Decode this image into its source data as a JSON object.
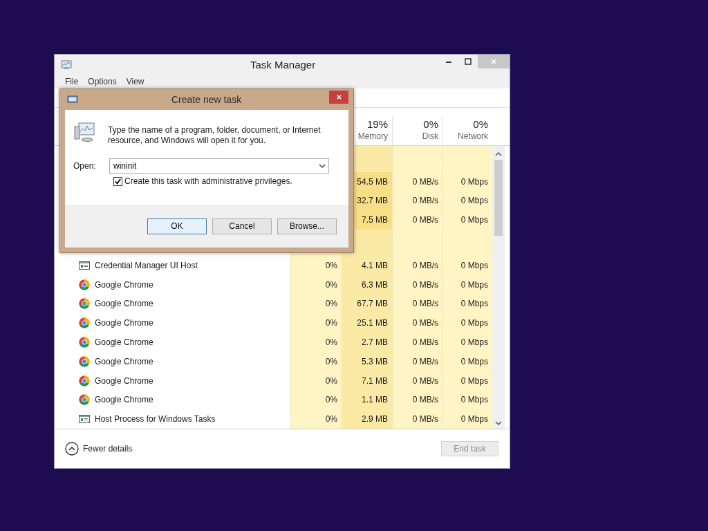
{
  "window": {
    "title": "Task Manager"
  },
  "menu": [
    "File",
    "Options",
    "View"
  ],
  "columns": [
    {
      "percent": "19%",
      "label": "Memory"
    },
    {
      "percent": "0%",
      "label": "Disk"
    },
    {
      "percent": "0%",
      "label": "Network"
    }
  ],
  "rows": [
    {
      "kind": "group"
    },
    {
      "kind": "hidden",
      "memory": "54.5 MB",
      "disk": "0 MB/s",
      "network": "0 Mbps"
    },
    {
      "kind": "hidden",
      "memory": "32.7 MB",
      "disk": "0 MB/s",
      "network": "0 Mbps"
    },
    {
      "kind": "hidden",
      "memory": "7.5 MB",
      "disk": "0 MB/s",
      "network": "0 Mbps"
    },
    {
      "kind": "group"
    },
    {
      "kind": "app",
      "name": "Credential Manager UI Host",
      "cpu": "0%",
      "memory": "4.1 MB",
      "disk": "0 MB/s",
      "network": "0 Mbps"
    },
    {
      "kind": "chrome",
      "name": "Google Chrome",
      "cpu": "0%",
      "memory": "6.3 MB",
      "disk": "0 MB/s",
      "network": "0 Mbps"
    },
    {
      "kind": "chrome",
      "name": "Google Chrome",
      "cpu": "0%",
      "memory": "67.7 MB",
      "disk": "0 MB/s",
      "network": "0 Mbps"
    },
    {
      "kind": "chrome",
      "name": "Google Chrome",
      "cpu": "0%",
      "memory": "25.1 MB",
      "disk": "0 MB/s",
      "network": "0 Mbps"
    },
    {
      "kind": "chrome",
      "name": "Google Chrome",
      "cpu": "0%",
      "memory": "2.7 MB",
      "disk": "0 MB/s",
      "network": "0 Mbps"
    },
    {
      "kind": "chrome",
      "name": "Google Chrome",
      "cpu": "0%",
      "memory": "5.3 MB",
      "disk": "0 MB/s",
      "network": "0 Mbps"
    },
    {
      "kind": "chrome",
      "name": "Google Chrome",
      "cpu": "0%",
      "memory": "7.1 MB",
      "disk": "0 MB/s",
      "network": "0 Mbps"
    },
    {
      "kind": "chrome",
      "name": "Google Chrome",
      "cpu": "0%",
      "memory": "1.1 MB",
      "disk": "0 MB/s",
      "network": "0 Mbps"
    },
    {
      "kind": "app",
      "name": "Host Process for Windows Tasks",
      "cpu": "0%",
      "memory": "2.9 MB",
      "disk": "0 MB/s",
      "network": "0 Mbps"
    }
  ],
  "footer": {
    "details_link": "Fewer details",
    "end_task": {
      "label": "End task",
      "disabled": true
    }
  },
  "dialog": {
    "title": "Create new task",
    "message": "Type the name of a program, folder, document, or Internet resource, and Windows will open it for you.",
    "open_label": "Open:",
    "open_value": "wininit",
    "admin": {
      "label": "Create this task with administrative privileges.",
      "checked": true
    },
    "buttons": [
      "OK",
      "Cancel",
      "Browse..."
    ]
  }
}
